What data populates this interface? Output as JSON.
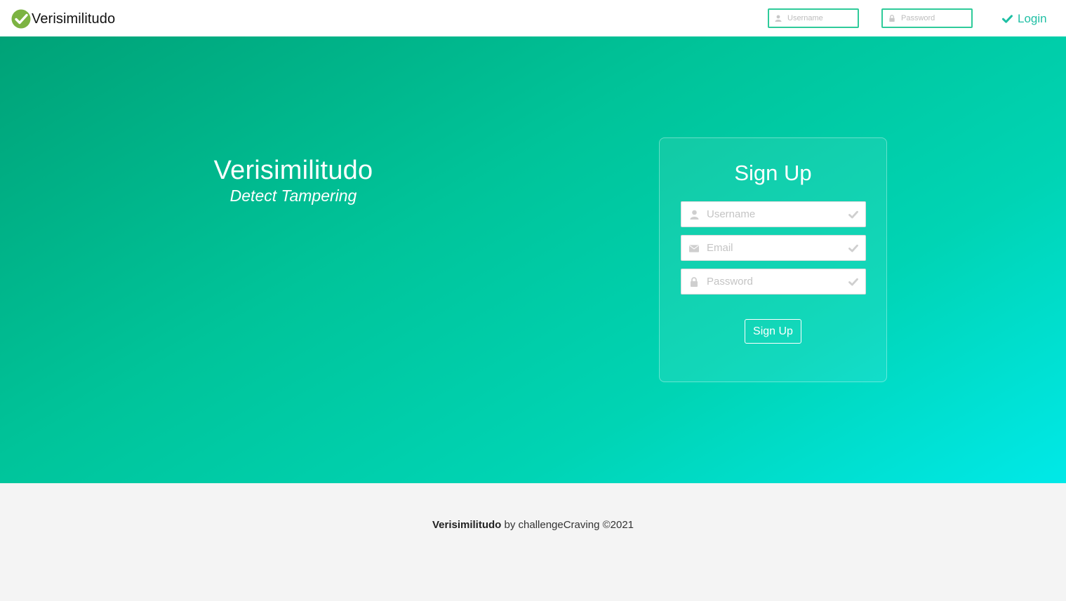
{
  "navbar": {
    "brand": "Verisimilitudo",
    "username_placeholder": "Username",
    "password_placeholder": "Password",
    "login_label": "Login"
  },
  "hero": {
    "title": "Verisimilitudo",
    "subtitle": "Detect Tampering"
  },
  "signup": {
    "title": "Sign Up",
    "username_placeholder": "Username",
    "email_placeholder": "Email",
    "password_placeholder": "Password",
    "button_label": "Sign Up"
  },
  "footer": {
    "brand": "Verisimilitudo",
    "by_text": "by challengeCraving",
    "copyright": "©2021"
  },
  "colors": {
    "accent": "#1fbfa4",
    "logo_green": "#7cb342",
    "gradient_start": "#00a277",
    "gradient_end": "#00e9e8"
  },
  "icons": [
    "check-circle-logo-icon",
    "user-icon",
    "lock-icon",
    "check-icon",
    "envelope-icon"
  ]
}
